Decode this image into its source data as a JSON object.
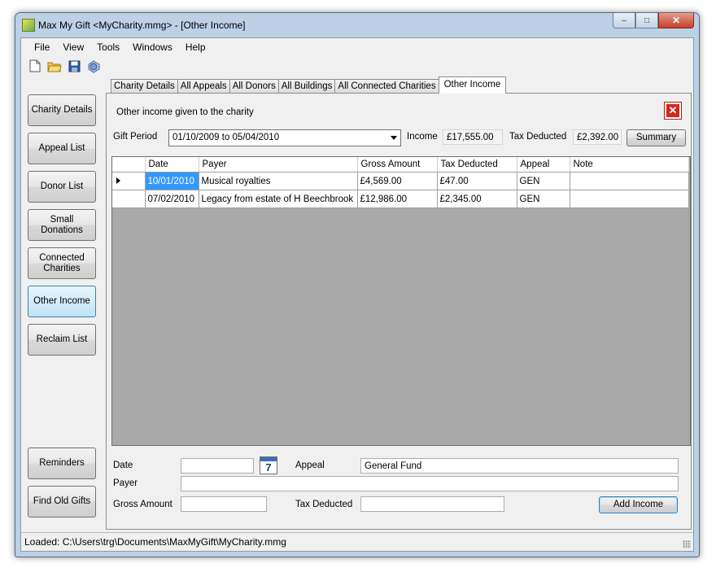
{
  "window": {
    "title": "Max My Gift <MyCharity.mmg>  - [Other Income]",
    "controls": {
      "minimize": "–",
      "restore": "□",
      "close": "✕"
    }
  },
  "menubar": [
    {
      "label": "File"
    },
    {
      "label": "View"
    },
    {
      "label": "Tools"
    },
    {
      "label": "Windows"
    },
    {
      "label": "Help"
    }
  ],
  "toolbar": [
    {
      "name": "new-document-icon"
    },
    {
      "name": "open-folder-icon"
    },
    {
      "name": "save-disk-icon"
    },
    {
      "name": "globe-print-icon"
    }
  ],
  "sidebar": {
    "top_buttons": [
      {
        "label": "Charity Details",
        "active": false
      },
      {
        "label": "Appeal List",
        "active": false
      },
      {
        "label": "Donor List",
        "active": false
      },
      {
        "label": "Small Donations",
        "active": false
      },
      {
        "label": "Connected Charities",
        "active": false
      },
      {
        "label": "Other Income",
        "active": true
      },
      {
        "label": "Reclaim List",
        "active": false
      }
    ],
    "bottom_buttons": [
      {
        "label": "Reminders"
      },
      {
        "label": "Find Old Gifts"
      }
    ]
  },
  "tabs": [
    {
      "label": "Charity Details",
      "active": false
    },
    {
      "label": "All Appeals",
      "active": false
    },
    {
      "label": "All Donors",
      "active": false
    },
    {
      "label": "All Buildings",
      "active": false
    },
    {
      "label": "All Connected Charities",
      "active": false
    },
    {
      "label": "Other Income",
      "active": true
    }
  ],
  "panel": {
    "heading": "Other income given to the charity",
    "gift_period_label": "Gift Period",
    "gift_period_value": "01/10/2009 to 05/04/2010",
    "income_label": "Income",
    "income_value": "£17,555.00",
    "tax_deducted_label": "Tax Deducted",
    "tax_deducted_value": "£2,392.00",
    "summary_button": "Summary"
  },
  "grid": {
    "columns": [
      "Date",
      "Payer",
      "Gross Amount",
      "Tax Deducted",
      "Appeal",
      "Note"
    ],
    "rows": [
      {
        "date": "10/01/2010",
        "payer": "Musical royalties",
        "gross": "£4,569.00",
        "tax": "£47.00",
        "appeal": "GEN",
        "note": "",
        "current": true
      },
      {
        "date": "07/02/2010",
        "payer": "Legacy from estate of H Beechbrook",
        "gross": "£12,986.00",
        "tax": "£2,345.00",
        "appeal": "GEN",
        "note": "",
        "current": false
      }
    ]
  },
  "form": {
    "date_label": "Date",
    "date_value": "",
    "calendar_day": "7",
    "appeal_label": "Appeal",
    "appeal_value": "General Fund",
    "payer_label": "Payer",
    "payer_value": "",
    "gross_label": "Gross Amount",
    "gross_value": "",
    "tax_label": "Tax Deducted",
    "tax_value": "",
    "add_button": "Add Income"
  },
  "status": {
    "text": "Loaded: C:\\Users\\trg\\Documents\\MaxMyGift\\MyCharity.mmg"
  },
  "colors": {
    "selection": "#3399ff",
    "grid_background": "#a9a9a9",
    "close_red": "#d3271d"
  }
}
